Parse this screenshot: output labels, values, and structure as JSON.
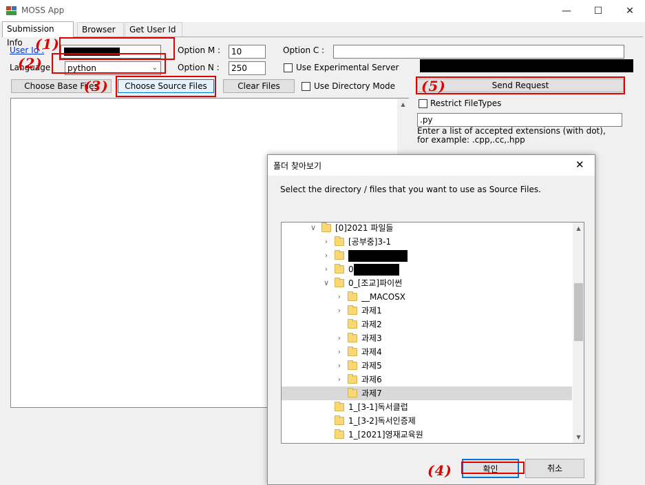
{
  "window": {
    "title": "MOSS App",
    "minimize_glyph": "—",
    "maximize_glyph": "☐",
    "close_glyph": "✕"
  },
  "tabs": [
    "Submission Info",
    "Browser",
    "Get User Id"
  ],
  "form": {
    "user_id_label": "User Id :",
    "user_id_value": "",
    "language_label": "Language",
    "language_value": "python",
    "option_m_label": "Option M :",
    "option_m_value": "10",
    "option_n_label": "Option N :",
    "option_n_value": "250",
    "option_c_label": "Option C :",
    "option_c_value": "",
    "experimental_label": "Use Experimental Server",
    "choose_base_label": "Choose Base Files",
    "choose_source_label": "Choose Source Files",
    "clear_files_label": "Clear Files",
    "directory_mode_label": "Use Directory Mode",
    "send_request_label": "Send Request",
    "restrict_label": "Restrict FileTypes",
    "extensions_value": ".py",
    "extensions_help": "Enter a list of accepted extensions (with dot),\nfor example: .cpp,.cc,.hpp"
  },
  "annotations": [
    "(1)",
    "(2)",
    "(3)",
    "(4)",
    "(5)"
  ],
  "dialog": {
    "title": "폴더 찾아보기",
    "close_glyph": "✕",
    "instruction": "Select the directory / files that you want to use as Source Files.",
    "ok_label": "확인",
    "cancel_label": "취소",
    "tree": [
      {
        "label": "[0]2021 파일들",
        "level": 0,
        "expander": "open"
      },
      {
        "label": "[공부중]3-1",
        "level": 1,
        "expander": "closed"
      },
      {
        "label": "",
        "level": 1,
        "expander": "closed",
        "redacted": true
      },
      {
        "label": "0",
        "level": 1,
        "expander": "closed",
        "redacted": true
      },
      {
        "label": "0_[조교]파이썬",
        "level": 1,
        "expander": "open"
      },
      {
        "label": "__MACOSX",
        "level": 2,
        "expander": "closed"
      },
      {
        "label": "과제1",
        "level": 2,
        "expander": "closed"
      },
      {
        "label": "과제2",
        "level": 2,
        "expander": "none"
      },
      {
        "label": "과제3",
        "level": 2,
        "expander": "closed"
      },
      {
        "label": "과제4",
        "level": 2,
        "expander": "closed"
      },
      {
        "label": "과제5",
        "level": 2,
        "expander": "closed"
      },
      {
        "label": "과제6",
        "level": 2,
        "expander": "closed"
      },
      {
        "label": "과제7",
        "level": 2,
        "expander": "none",
        "selected": true
      },
      {
        "label": "1_[3-1]독서클럽",
        "level": 1,
        "expander": "none"
      },
      {
        "label": "1_[3-2]독서인증제",
        "level": 1,
        "expander": "none"
      },
      {
        "label": "1_[2021]영재교육원",
        "level": 1,
        "expander": "none"
      }
    ]
  },
  "colors": {
    "annotation_red": "#e00000",
    "focus_blue": "#0078d7",
    "folder_yellow": "#f8d775"
  }
}
